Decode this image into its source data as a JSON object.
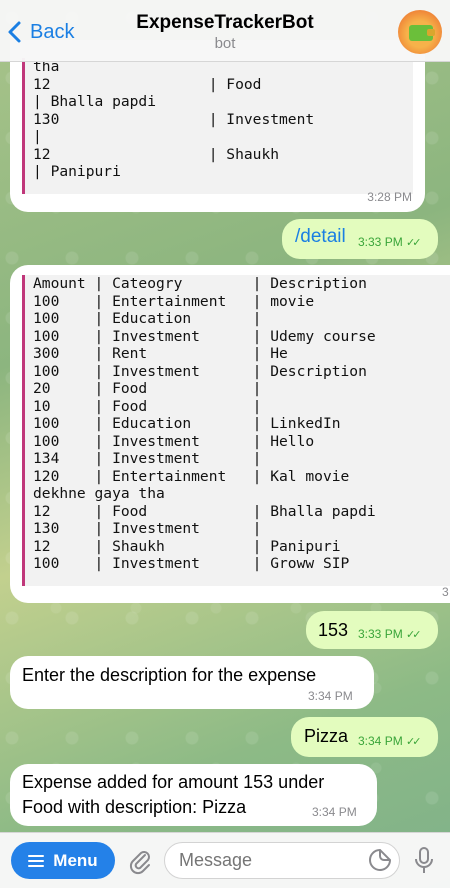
{
  "header": {
    "back_label": "Back",
    "title": "ExpenseTrackerBot",
    "subtitle": "bot"
  },
  "messages": {
    "first_bot": {
      "code": "tha\n12                  | Food\n| Bhalla papdi\n130                 | Investment\n|\n12                  | Shaukh\n| Panipuri",
      "time": "3:28 PM"
    },
    "detail_cmd": {
      "text": "/detail",
      "time": "3:33 PM"
    },
    "detail_bot": {
      "code": "Amount | Cateogry        | Description\n100    | Entertainment   | movie\n100    | Education       |\n100    | Investment      | Udemy course\n300    | Rent            | He\n100    | Investment      | Description\n20     | Food            |\n10     | Food            |\n100    | Education       | LinkedIn\n100    | Investment      | Hello\n134    | Investment      |\n120    | Entertainment   | Kal movie\ndekhne gaya tha\n12     | Food            | Bhalla papdi\n130    | Investment      |\n12     | Shaukh          | Panipuri\n100    | Investment      | Groww SIP",
      "time": "3"
    },
    "amount_msg": {
      "text": "153",
      "time": "3:33 PM"
    },
    "prompt_bot": {
      "text": "Enter the description for the expense",
      "time": "3:34 PM"
    },
    "pizza_msg": {
      "text": "Pizza",
      "time": "3:34 PM"
    },
    "confirm_bot": {
      "line1": "Expense added for amount 153 under",
      "line2": "Food with description: Pizza",
      "time": "3:34 PM"
    }
  },
  "input_bar": {
    "menu_label": "Menu",
    "placeholder": "Message"
  },
  "colors": {
    "accent": "#2481e8",
    "outgoing_bubble": "#e3fcbe",
    "code_border": "#c0377a",
    "read_check": "#3aa53a"
  }
}
